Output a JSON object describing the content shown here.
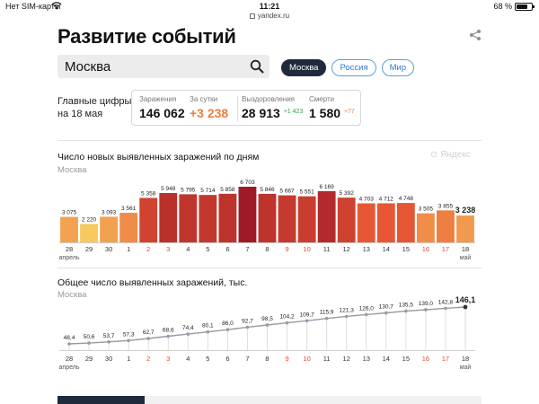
{
  "status_bar": {
    "carrier": "Нет SIM-карты",
    "time": "11:21",
    "battery": "68 %"
  },
  "browser": {
    "url": "yandex.ru"
  },
  "page": {
    "title": "Развитие событий"
  },
  "search": {
    "value": "Москва"
  },
  "region_tabs": [
    {
      "label": "Москва",
      "active": true
    },
    {
      "label": "Россия",
      "active": false
    },
    {
      "label": "Мир",
      "active": false
    }
  ],
  "key_figures": {
    "label_line1": "Главные цифры",
    "label_line2": "на 18 мая",
    "infected": {
      "label": "Заражения",
      "value": "146 062"
    },
    "daily": {
      "label": "За сутки",
      "value": "+3 238"
    },
    "recovered": {
      "label": "Выздоровления",
      "value": "28 913",
      "delta": "+1 423"
    },
    "deaths": {
      "label": "Смерти",
      "value": "1 580",
      "delta": "+77"
    }
  },
  "watermark": "Яндекс",
  "colors": {
    "accent_orange": "#ef7c3b",
    "dark": "#1f2a3c",
    "link_blue": "#2a7ad0",
    "holiday_red": "#e8462d"
  },
  "chart_data": [
    {
      "type": "bar",
      "title": "Число новых выявленных заражений по дням",
      "subtitle": "Москва",
      "categories": [
        "28",
        "29",
        "30",
        "1",
        "2",
        "3",
        "4",
        "5",
        "6",
        "7",
        "8",
        "9",
        "10",
        "11",
        "12",
        "13",
        "14",
        "15",
        "16",
        "17",
        "18"
      ],
      "value_labels": [
        "3 075",
        "2 220",
        "3 093",
        "3 561",
        "5 358",
        "5 948",
        "5 795",
        "5 714",
        "5 858",
        "6 703",
        "5 846",
        "5 667",
        "5 551",
        "6 169",
        "5 392",
        "4 703",
        "4 712",
        "4 748",
        "3 505",
        "3 855",
        "3 238"
      ],
      "values": [
        3075,
        2220,
        3093,
        3561,
        5358,
        5948,
        5795,
        5714,
        5858,
        6703,
        5846,
        5667,
        5551,
        6169,
        5392,
        4703,
        4712,
        4748,
        3505,
        3855,
        3238
      ],
      "month_labels": [
        {
          "index": 0,
          "text": "апрель"
        },
        {
          "index": 20,
          "text": "май"
        }
      ],
      "holiday_indices": [
        4,
        5,
        11,
        12,
        18,
        19
      ],
      "ylim": [
        0,
        6703
      ]
    },
    {
      "type": "line",
      "title": "Общее число выявленных заражений, тыс.",
      "subtitle": "Москва",
      "categories": [
        "28",
        "29",
        "30",
        "1",
        "2",
        "3",
        "4",
        "5",
        "6",
        "7",
        "8",
        "9",
        "10",
        "11",
        "12",
        "13",
        "14",
        "15",
        "16",
        "17",
        "18"
      ],
      "value_labels": [
        "48,4",
        "50,6",
        "53,7",
        "57,3",
        "62,7",
        "68,6",
        "74,4",
        "80,1",
        "86,0",
        "92,7",
        "98,5",
        "104,2",
        "109,7",
        "115,9",
        "121,3",
        "126,0",
        "130,7",
        "135,5",
        "139,0",
        "142,8",
        "146,1"
      ],
      "values": [
        48.4,
        50.6,
        53.7,
        57.3,
        62.7,
        68.6,
        74.4,
        80.1,
        86.0,
        92.7,
        98.5,
        104.2,
        109.7,
        115.9,
        121.3,
        126.0,
        130.7,
        135.5,
        139.0,
        142.8,
        146.1
      ],
      "month_labels": [
        {
          "index": 0,
          "text": "апрель"
        },
        {
          "index": 20,
          "text": "май"
        }
      ],
      "holiday_indices": [
        4,
        5,
        11,
        12,
        18,
        19
      ],
      "ylim": [
        0,
        146.1
      ]
    }
  ]
}
